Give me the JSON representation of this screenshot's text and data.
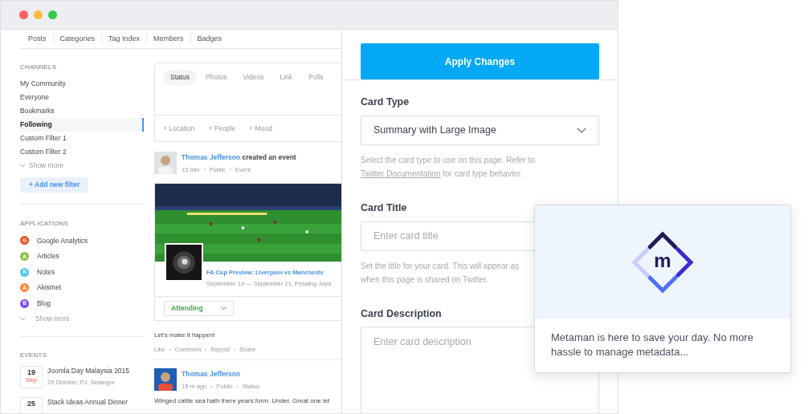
{
  "window": {
    "controls": [
      {
        "color": "#fc605c"
      },
      {
        "color": "#fdbc40"
      },
      {
        "color": "#34c84a"
      }
    ]
  },
  "nav_tabs": [
    "Posts",
    "Categories",
    "Tag Index",
    "Members",
    "Badges"
  ],
  "sidebar": {
    "channels": {
      "title": "CHANNELS",
      "items": [
        {
          "label": "My Community",
          "selected": false
        },
        {
          "label": "Everyone",
          "selected": false
        },
        {
          "label": "Bookmarks",
          "selected": false
        },
        {
          "label": "Following",
          "selected": true
        },
        {
          "label": "Custom Filter 1",
          "selected": false
        },
        {
          "label": "Custom Filter 2",
          "selected": false
        }
      ],
      "show_more": "Show more",
      "add_button": "+ Add new filter"
    },
    "applications": {
      "title": "APPLICATIONS",
      "items": [
        {
          "badge": "G",
          "label": "Google Analytics",
          "color": "#f4511e"
        },
        {
          "badge": "A",
          "label": "Articles",
          "color": "#8bc34a"
        },
        {
          "badge": "N",
          "label": "Notes",
          "color": "#4fc3f7"
        },
        {
          "badge": "A",
          "label": "Akismet",
          "color": "#ff8a3d"
        },
        {
          "badge": "B",
          "label": "Blog",
          "color": "#7c4dff"
        }
      ],
      "show_more": "Show more"
    },
    "events": {
      "title": "EVENTS",
      "items": [
        {
          "day": "19",
          "month": "Sep",
          "title": "Joomla Day Malaysia 2015",
          "subtitle": "25 October, PJ, Selangor"
        },
        {
          "day": "25",
          "title": "Stack Ideas Annual Dinner"
        }
      ]
    }
  },
  "composer": {
    "tabs": [
      {
        "label": "Status",
        "selected": true
      },
      {
        "label": "Photos",
        "selected": false
      },
      {
        "label": "Videos",
        "selected": false
      },
      {
        "label": "Link",
        "selected": false
      },
      {
        "label": "Polls",
        "selected": false
      }
    ],
    "actions": [
      "+ Location",
      "+ People",
      "+ Mood"
    ]
  },
  "posts": [
    {
      "kind": "event",
      "author": "Thomas Jefferson",
      "action": "created an event",
      "meta": [
        "15 min",
        "Public",
        "Event"
      ],
      "event_title": "FA Cup Preview: Liverpool vs Mancheste",
      "event_dates": "September 19 — September 21, Petaling Jaya",
      "rsvp": "Attending",
      "message": "Let's make it happen!",
      "actions": [
        "Like",
        "Comment",
        "Repost",
        "Share"
      ]
    },
    {
      "kind": "status",
      "author": "Thomas Jefferson",
      "meta": [
        "15 m ago",
        "Public",
        "Status"
      ],
      "message": "Winged cattle sea hath there years form. Under. Great one let"
    }
  ],
  "form": {
    "apply_button": "Apply Changes",
    "card_type": {
      "label": "Card Type",
      "value": "Summary with Large Image",
      "hint_before": "Select the card type to use on this page. Refer to",
      "hint_link": "Twitter Documentation",
      "hint_after": "for card type behavior."
    },
    "card_title": {
      "label": "Card Title",
      "placeholder": "Enter card title",
      "hint_lines": [
        "Set the title for your card. This will appear as",
        "when this page is shared on Twitter."
      ]
    },
    "card_description": {
      "label": "Card Description",
      "placeholder": "Enter card description"
    }
  },
  "popup": {
    "logo_letter": "m",
    "message": "Metaman is here to save your day. No more hassle to manage metadata..."
  }
}
